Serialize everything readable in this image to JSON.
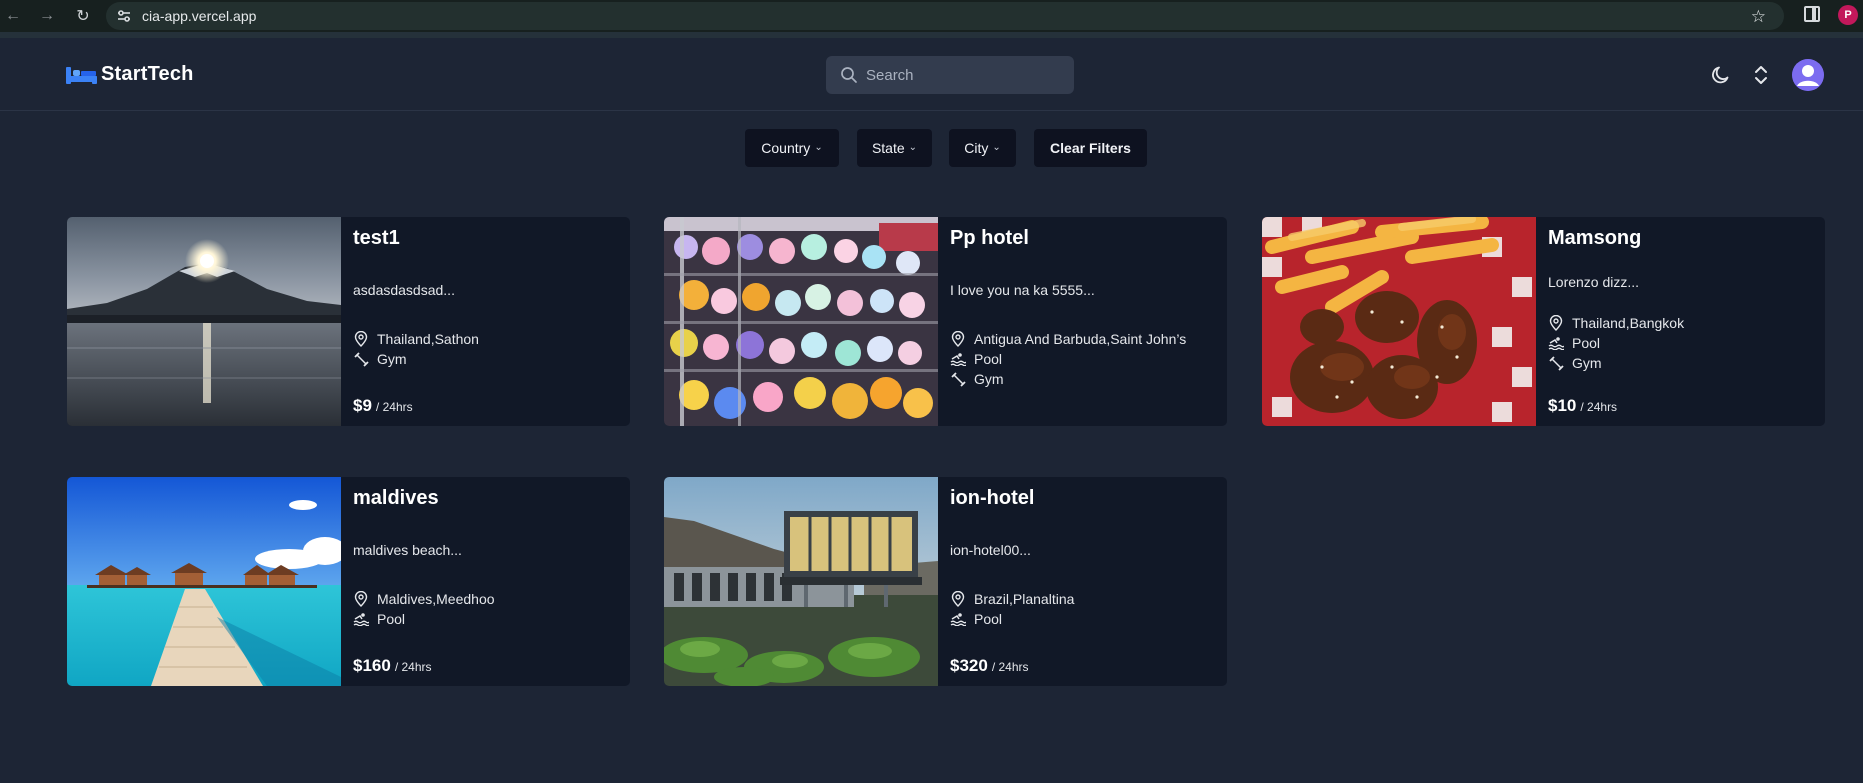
{
  "browser": {
    "url": "cia-app.vercel.app",
    "profile_initial": "P"
  },
  "header": {
    "brand": "StartTech",
    "search_placeholder": "Search"
  },
  "filters": {
    "country": "Country",
    "state": "State",
    "city": "City",
    "clear": "Clear Filters"
  },
  "hotels": [
    {
      "name": "test1",
      "description": "asdasdasdsad...",
      "location": "Thailand,Sathon",
      "amenities": [
        "Gym"
      ],
      "price": "$9",
      "unit": "/ 24hrs"
    },
    {
      "name": "Pp hotel",
      "description": "I love you na ka 5555...",
      "location": "Antigua And Barbuda,Saint John’s",
      "amenities": [
        "Pool",
        "Gym"
      ],
      "price": "$",
      "unit": ""
    },
    {
      "name": "Mamsong",
      "description": "Lorenzo dizz...",
      "location": "Thailand,Bangkok",
      "amenities": [
        "Pool",
        "Gym"
      ],
      "price": "$10",
      "unit": "/ 24hrs"
    },
    {
      "name": "maldives",
      "description": "maldives beach...",
      "location": "Maldives,Meedhoo",
      "amenities": [
        "Pool"
      ],
      "price": "$160",
      "unit": "/ 24hrs"
    },
    {
      "name": "ion-hotel",
      "description": "ion-hotel00...",
      "location": "Brazil,Planaltina",
      "amenities": [
        "Pool"
      ],
      "price": "$320",
      "unit": "/ 24hrs"
    }
  ]
}
